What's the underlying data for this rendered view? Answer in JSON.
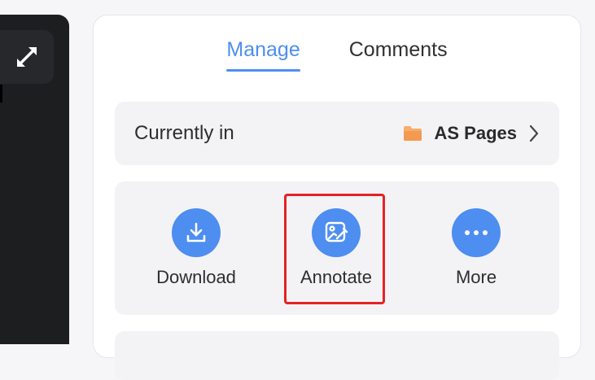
{
  "sidebar": {
    "expand_icon": "expand-arrows-icon"
  },
  "tabs": [
    {
      "label": "Manage",
      "active": true
    },
    {
      "label": "Comments",
      "active": false
    }
  ],
  "location": {
    "label": "Currently in",
    "folder_icon": "folder-icon",
    "folder_color": "#f5a25a",
    "name": "AS Pages"
  },
  "actions": [
    {
      "label": "Download",
      "icon": "download-icon"
    },
    {
      "label": "Annotate",
      "icon": "annotate-icon"
    },
    {
      "label": "More",
      "icon": "more-dots-icon"
    }
  ],
  "colors": {
    "accent": "#4d8ef0",
    "highlight": "#e62323"
  }
}
